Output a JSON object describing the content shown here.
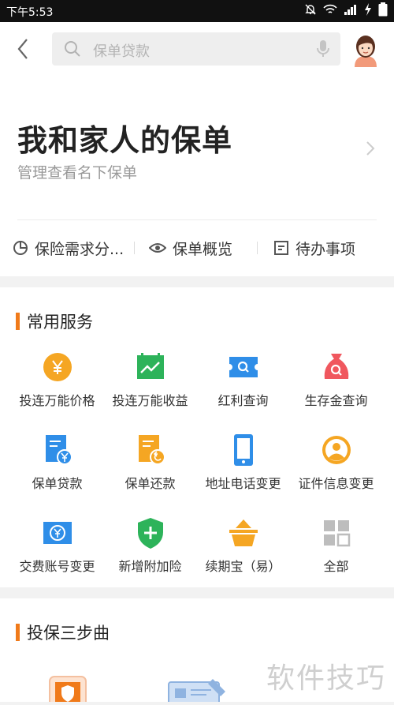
{
  "status": {
    "time": "下午5:53"
  },
  "search": {
    "placeholder": "保单贷款"
  },
  "hero": {
    "title": "我和家人的保单",
    "subtitle": "管理查看名下保单"
  },
  "quick_links": [
    {
      "label": "保险需求分...",
      "icon": "pie-chart-icon"
    },
    {
      "label": "保单概览",
      "icon": "eye-icon"
    },
    {
      "label": "待办事项",
      "icon": "todo-list-icon"
    }
  ],
  "services": {
    "title": "常用服务",
    "items": [
      {
        "label": "投连万能价格",
        "icon": "yen-coin-icon",
        "color": "#f5a623"
      },
      {
        "label": "投连万能收益",
        "icon": "calendar-trend-icon",
        "color": "#2db35a"
      },
      {
        "label": "红利查询",
        "icon": "ticket-search-icon",
        "color": "#2f8ee8"
      },
      {
        "label": "生存金查询",
        "icon": "money-bag-icon",
        "color": "#f0575e"
      },
      {
        "label": "保单贷款",
        "icon": "policy-loan-icon",
        "color": "#2f8ee8"
      },
      {
        "label": "保单还款",
        "icon": "policy-repay-icon",
        "color": "#f5a623"
      },
      {
        "label": "地址电话变更",
        "icon": "phone-icon",
        "color": "#2f8ee8"
      },
      {
        "label": "证件信息变更",
        "icon": "person-id-icon",
        "color": "#f5a623"
      },
      {
        "label": "交费账号变更",
        "icon": "account-exchange-icon",
        "color": "#2f8ee8"
      },
      {
        "label": "新增附加险",
        "icon": "shield-plus-icon",
        "color": "#2db35a"
      },
      {
        "label": "续期宝（易）",
        "icon": "basket-icon",
        "color": "#f5a623"
      },
      {
        "label": "全部",
        "icon": "grid-all-icon",
        "color": "#bdbdbd"
      }
    ]
  },
  "steps": {
    "title": "投保三步曲"
  },
  "watermark": "软件技巧",
  "colors": {
    "accent": "#f07a1a"
  }
}
